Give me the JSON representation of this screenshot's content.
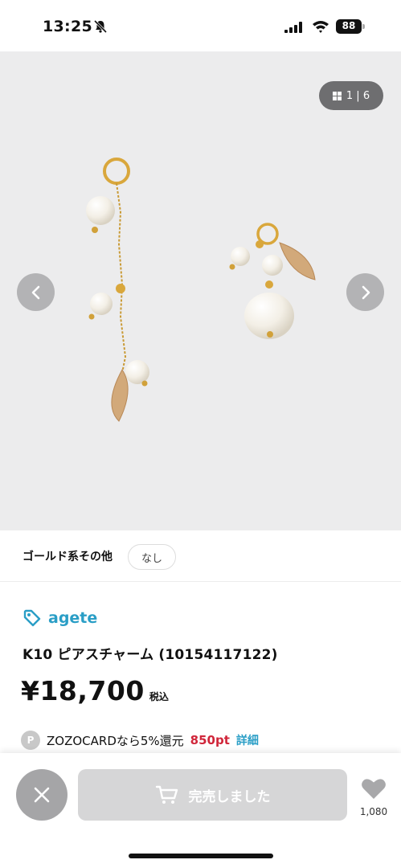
{
  "status_bar": {
    "time": "13:25",
    "battery": "88"
  },
  "gallery": {
    "counter": "1 | 6"
  },
  "color_row": {
    "color_name": "ゴールド系その他",
    "size": "なし"
  },
  "product": {
    "brand": "agete",
    "name": "K10 ピアスチャーム (10154117122)",
    "price": "¥18,700",
    "tax_label": "税込",
    "card_text": "ZOZOCARDなら5%還元",
    "points": "850pt",
    "detail_link": "詳細",
    "p_badge": "P"
  },
  "bottom_bar": {
    "cart_label": "完売しました",
    "favorite_count": "1,080"
  },
  "colors": {
    "brand_blue": "#2a9ec6",
    "points_red": "#d0263a",
    "disabled_button": "#d6d6d7"
  },
  "icons": [
    "bell-slash-icon",
    "signal-icon",
    "wifi-icon",
    "battery-icon",
    "grid-icon",
    "chevron-left-icon",
    "chevron-right-icon",
    "tag-icon",
    "close-icon",
    "cart-icon",
    "heart-icon"
  ]
}
